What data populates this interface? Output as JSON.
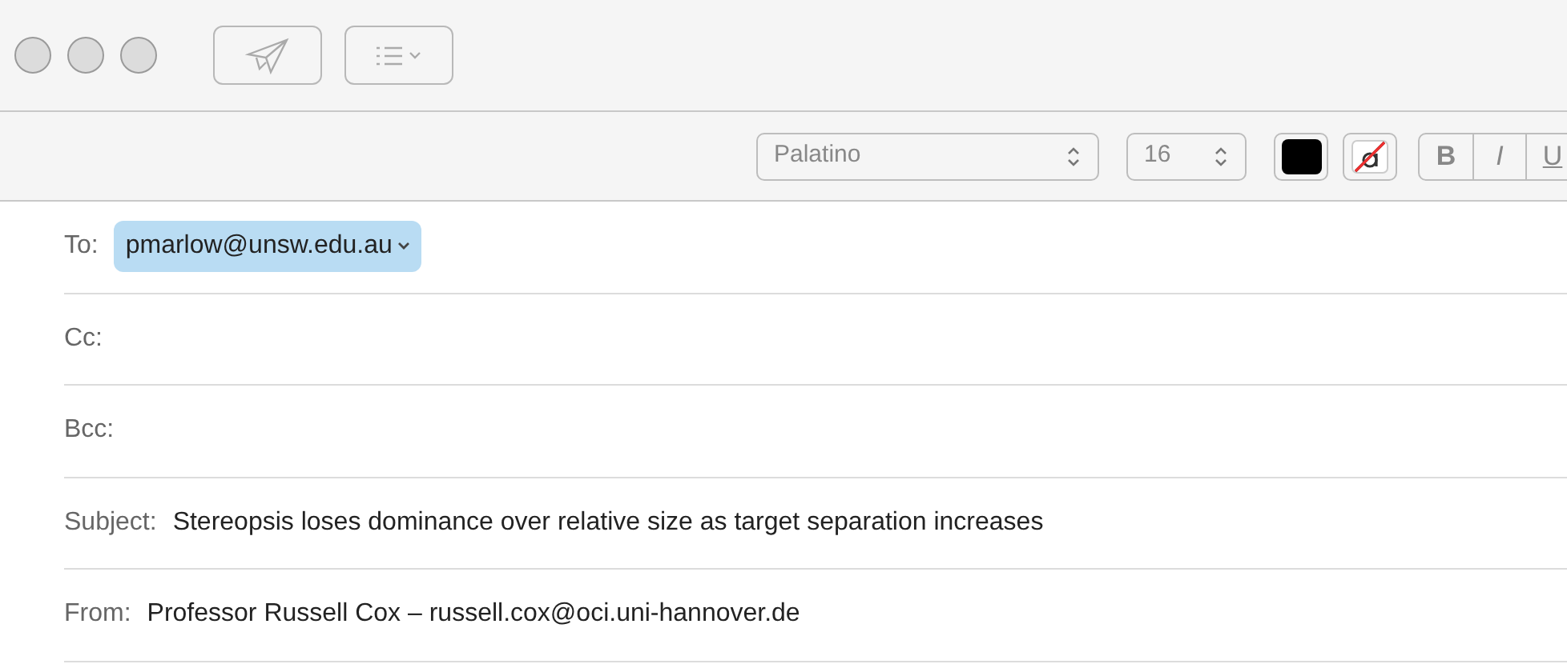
{
  "format_bar": {
    "font": "Palatino",
    "size": "16",
    "styles": [
      "B",
      "I",
      "U"
    ]
  },
  "headers": [
    {
      "label": "To:",
      "kind": "recipients",
      "tokens": [
        "pmarlow@unsw.edu.au"
      ]
    },
    {
      "label": "Cc:",
      "kind": "recipients"
    },
    {
      "label": "Bcc:",
      "kind": "recipients"
    },
    {
      "label": "Subject:",
      "kind": "text",
      "value": "Stereopsis loses dominance over relative size as target separation increases"
    },
    {
      "label": "From:",
      "kind": "text",
      "value": "Professor Russell Cox – russell.cox@oci.uni-hannover.de"
    }
  ]
}
